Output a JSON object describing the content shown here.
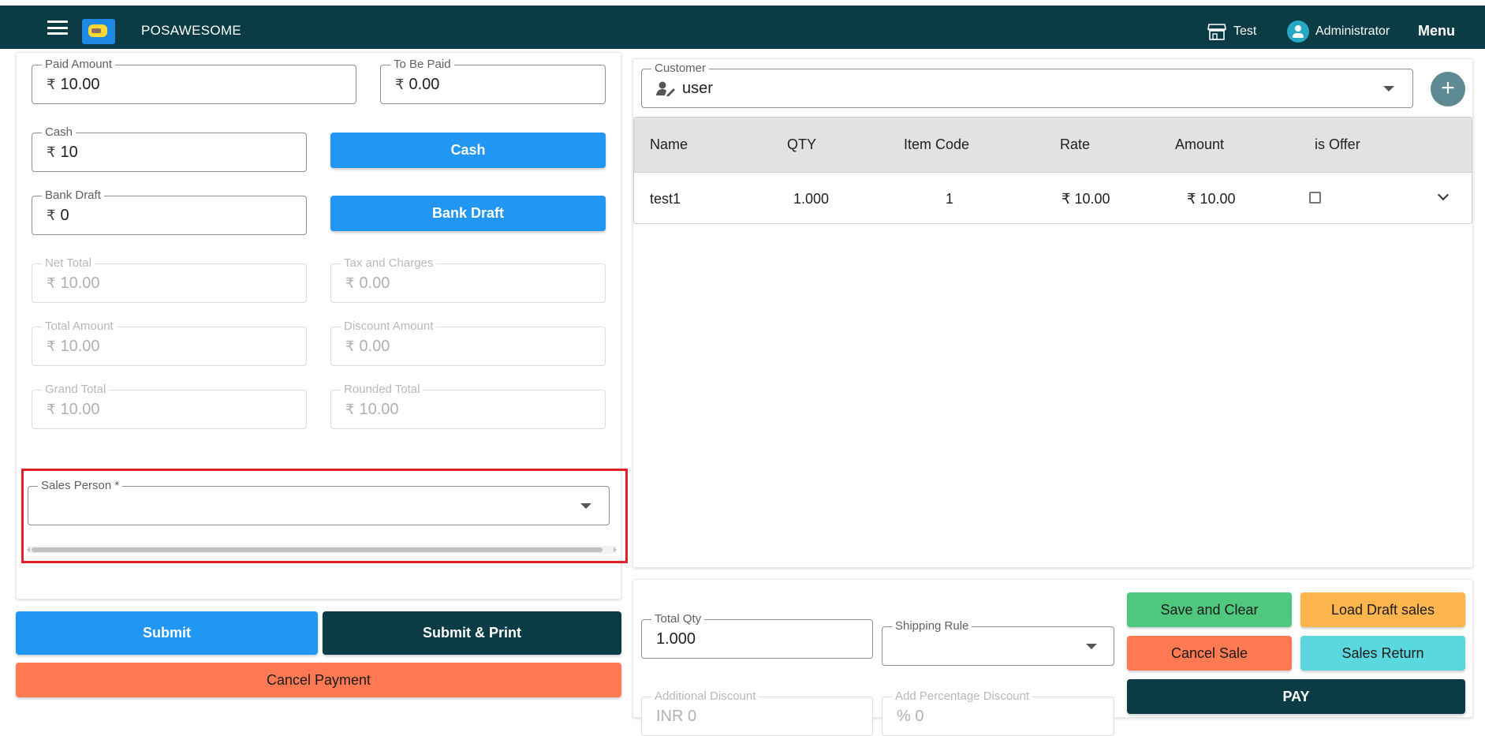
{
  "appbar": {
    "brand": "POSAWESOME",
    "store": "Test",
    "user": "Administrator",
    "menu": "Menu"
  },
  "currency_symbol": "₹",
  "payment": {
    "paid_amount": {
      "label": "Paid Amount",
      "value": "10.00"
    },
    "to_be_paid": {
      "label": "To Be Paid",
      "value": "0.00"
    },
    "cash": {
      "label": "Cash",
      "value": "10",
      "button": "Cash"
    },
    "bank_draft": {
      "label": "Bank Draft",
      "value": "0",
      "button": "Bank Draft"
    },
    "net_total": {
      "label": "Net Total",
      "value": "10.00"
    },
    "tax_and_charges": {
      "label": "Tax and Charges",
      "value": "0.00"
    },
    "total_amount": {
      "label": "Total Amount",
      "value": "10.00"
    },
    "discount_amount": {
      "label": "Discount Amount",
      "value": "0.00"
    },
    "grand_total": {
      "label": "Grand Total",
      "value": "10.00"
    },
    "rounded_total": {
      "label": "Rounded Total",
      "value": "10.00"
    },
    "sales_person": {
      "label": "Sales Person *",
      "value": ""
    },
    "submit": "Submit",
    "submit_print": "Submit & Print",
    "cancel_payment": "Cancel Payment"
  },
  "customer": {
    "label": "Customer",
    "value": "user"
  },
  "items_table": {
    "headers": [
      "Name",
      "QTY",
      "Item Code",
      "Rate",
      "Amount",
      "is Offer"
    ],
    "rows": [
      {
        "name": "test1",
        "qty": "1.000",
        "item_code": "1",
        "rate": "₹ 10.00",
        "amount": "₹ 10.00",
        "is_offer": false
      }
    ]
  },
  "summary": {
    "total_qty": {
      "label": "Total Qty",
      "value": "1.000"
    },
    "shipping_rule": {
      "label": "Shipping Rule",
      "value": ""
    },
    "additional_discount": {
      "label": "Additional Discount",
      "value": "INR 0"
    },
    "add_percentage_discount": {
      "label": "Add Percentage Discount",
      "value": "% 0"
    },
    "save_and_clear": "Save and Clear",
    "load_draft_sales": "Load Draft sales",
    "cancel_sale": "Cancel Sale",
    "sales_return": "Sales Return",
    "pay": "PAY"
  },
  "colors": {
    "appbar": "#0b3b45",
    "primary": "#2196f3",
    "danger": "#ff7a52",
    "success": "#4fc77d",
    "warning": "#ffb54d",
    "info": "#5ad8de",
    "highlight": "#e0202a"
  }
}
